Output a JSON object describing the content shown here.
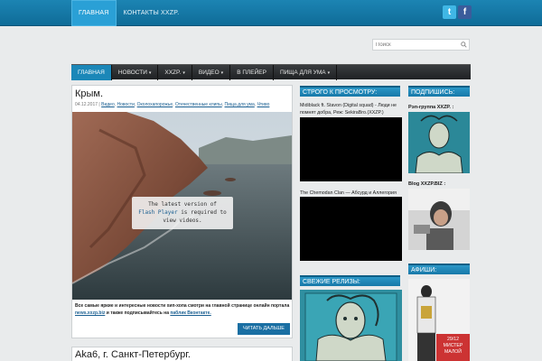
{
  "topnav": {
    "items": [
      {
        "label": "ГЛАВНАЯ"
      },
      {
        "label": "КОНТАКТЫ XXZP."
      }
    ]
  },
  "social": {
    "twitter": "t",
    "facebook": "f"
  },
  "search": {
    "placeholder": "Поиск"
  },
  "mainnav": {
    "items": [
      {
        "label": "ГЛАВНАЯ",
        "caret": ""
      },
      {
        "label": "НОВОСТИ",
        "caret": "▾"
      },
      {
        "label": "XXZP.",
        "caret": "▾"
      },
      {
        "label": "ВИДЕО",
        "caret": "▾"
      },
      {
        "label": "В ПЛЕЙЕР",
        "caret": ""
      },
      {
        "label": "ПИЩА ДЛЯ УМА",
        "caret": "▾"
      }
    ]
  },
  "post1": {
    "title": "Крым.",
    "date": "04.12.2017",
    "sep": "|",
    "categories": [
      "Видео",
      "Новости",
      "Околохапорожье",
      "Отечественные клипы",
      "Пища для ума",
      "Чтиво"
    ],
    "flash_line1": "The latest version of",
    "flash_link": "Flash Player",
    "flash_line2": " is required to",
    "flash_line3": "view videos.",
    "excerpt_1": "Все самые яркие и интересные новости хип-хопа смотри на главной странице онлайн портала ",
    "excerpt_link1": "news.xxzp.biz",
    "excerpt_2": " и также подписывайтесь на ",
    "excerpt_link2": "паблик Вконтакте.",
    "readmore": "ЧИТАТЬ ДАЛЬШЕ"
  },
  "post2": {
    "title": "Aka6, г. Санкт-Петербург."
  },
  "middle": {
    "heading1": "СТРОГО К ПРОСМОТРУ:",
    "video1_caption": "Midiblack ft. Stavon (Digital squad) - Люди не помнят добра, Реж: SekiraBro.(XXZP.)",
    "video2_caption": "The Chemodan Clan — Абсурд и Аллегория",
    "heading2": "СВЕЖИЕ РЕЛИЗЫ:"
  },
  "right": {
    "heading1": "ПОДПИШИСЬ:",
    "label1": "Рэп-группа XXZP. :",
    "label2": "Blog XXZP.BIZ :",
    "heading2": "АФИШИ:",
    "promo_date": "29/12",
    "promo_text": "МИСТЕР МАЛОЙ"
  },
  "colors": {
    "accent": "#1b87b8",
    "nav_dark": "#2a2c2e",
    "link": "#1a5f91"
  }
}
